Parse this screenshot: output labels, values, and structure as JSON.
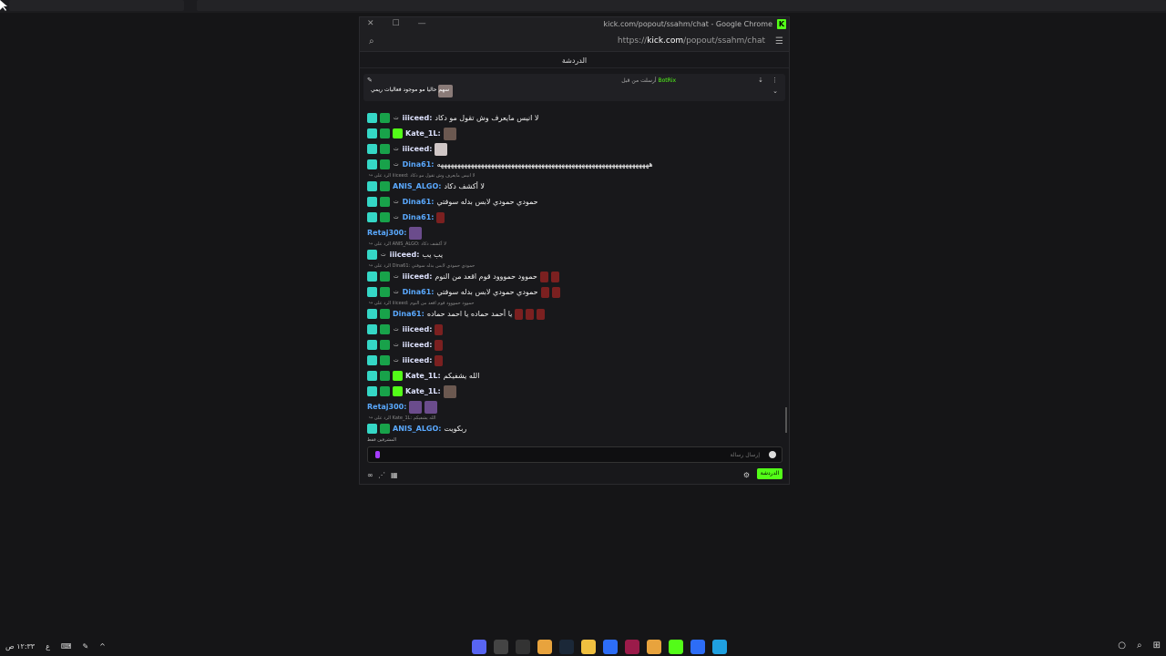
{
  "window": {
    "title": "kick.com/popout/ssahm/chat - Google Chrome",
    "url_prefix": "https://",
    "url_domain": "kick.com",
    "url_path": "/popout/ssahm/chat",
    "logo_letter": "K",
    "controls": [
      "✕",
      "☐",
      "—"
    ]
  },
  "chat": {
    "header": "الدردشة",
    "pinned": {
      "sender": "BotRix",
      "meta": "أرسلت من قبل",
      "message": "سهم حاليا مو موجود فعاليات ريمي"
    },
    "messages": [
      {
        "reply": null,
        "badges": [
          "vip",
          "sub"
        ],
        "tag": "ت",
        "user": "iiiceed",
        "user_color": "white",
        "text": "لا انيس مايعرف وش تقول مو دكاد",
        "emotes": []
      },
      {
        "reply": null,
        "badges": [
          "vip",
          "sub",
          "green"
        ],
        "tag": "",
        "user": "Kate_1L",
        "user_color": "white",
        "text": "",
        "emotes": [
          "face"
        ]
      },
      {
        "reply": null,
        "badges": [
          "vip",
          "sub"
        ],
        "tag": "ت",
        "user": "iiiceed",
        "user_color": "white",
        "text": "",
        "emotes": [
          "girl"
        ]
      },
      {
        "reply": null,
        "badges": [
          "vip",
          "sub"
        ],
        "tag": "ت",
        "user": "Dina61",
        "user_color": "blue",
        "text": "هههههههههههههههههههههههههههههههههههههههههههههههههههههههههههههههه",
        "emotes": []
      },
      {
        "reply": "الرد على iiiceed: لا انيس مايعرف وش تقول مو دكاد",
        "badges": [
          "vip",
          "sub"
        ],
        "tag": "",
        "user": "ANIS_ALGO",
        "user_color": "blue",
        "text": "لا أكشف دكاد",
        "emotes": []
      },
      {
        "reply": null,
        "badges": [
          "vip",
          "sub"
        ],
        "tag": "ت",
        "user": "Dina61",
        "user_color": "blue",
        "text": "حمودي حمودي لابس بدله سوفتي",
        "emotes": []
      },
      {
        "reply": null,
        "badges": [
          "vip",
          "sub"
        ],
        "tag": "ت",
        "user": "Dina61",
        "user_color": "blue",
        "text": "",
        "emotes": [
          "rose"
        ]
      },
      {
        "reply": null,
        "badges": [],
        "tag": "",
        "user": "Retaj300",
        "user_color": "blue",
        "text": "",
        "emotes": [
          "purple"
        ]
      },
      {
        "reply": "الرد على ANIS_ALGO: لا أكشف دكاد",
        "badges": [
          "vip"
        ],
        "tag": "ت",
        "user": "iiiceed",
        "user_color": "white",
        "text": "يب يب",
        "emotes": []
      },
      {
        "reply": "الرد على Dina61: حمودي حمودي لابس بدله سوفتي",
        "badges": [
          "vip",
          "sub"
        ],
        "tag": "ت",
        "user": "iiiceed",
        "user_color": "white",
        "text": "حموود حمووود قوم اقعد من النوم",
        "emotes": [
          "rose",
          "rose"
        ]
      },
      {
        "reply": null,
        "badges": [
          "vip",
          "sub"
        ],
        "tag": "ت",
        "user": "Dina61",
        "user_color": "blue",
        "text": "حمودي حمودي لابس بدله سوفتي",
        "emotes": [
          "rose",
          "rose"
        ]
      },
      {
        "reply": "الرد على iiiceed: حموود حمووود قوم اقعد من النوم",
        "badges": [
          "vip",
          "sub"
        ],
        "tag": "",
        "user": "Dina61",
        "user_color": "blue",
        "text": "يا أحمد حماده يا احمد حماده",
        "emotes": [
          "rose",
          "rose",
          "rose"
        ]
      },
      {
        "reply": null,
        "badges": [
          "vip",
          "sub"
        ],
        "tag": "ت",
        "user": "iiiceed",
        "user_color": "white",
        "text": "",
        "emotes": [
          "rose"
        ]
      },
      {
        "reply": null,
        "badges": [
          "vip",
          "sub"
        ],
        "tag": "ت",
        "user": "iiiceed",
        "user_color": "white",
        "text": "",
        "emotes": [
          "rose"
        ]
      },
      {
        "reply": null,
        "badges": [
          "vip",
          "sub"
        ],
        "tag": "ت",
        "user": "iiiceed",
        "user_color": "white",
        "text": "",
        "emotes": [
          "rose"
        ]
      },
      {
        "reply": null,
        "badges": [
          "vip",
          "sub",
          "green"
        ],
        "tag": "",
        "user": "Kate_1L",
        "user_color": "white",
        "text": "الله يشفيكم",
        "emotes": []
      },
      {
        "reply": null,
        "badges": [
          "vip",
          "sub",
          "green"
        ],
        "tag": "",
        "user": "Kate_1L",
        "user_color": "white",
        "text": "",
        "emotes": [
          "face"
        ]
      },
      {
        "reply": null,
        "badges": [],
        "tag": "",
        "user": "Retaj300",
        "user_color": "blue",
        "text": "",
        "emotes": [
          "purple",
          "purple"
        ]
      },
      {
        "reply": "الرد على Kate_1L: الله يشفيكم",
        "badges": [
          "vip",
          "sub"
        ],
        "tag": "",
        "user": "ANIS_ALGO",
        "user_color": "blue",
        "text": "ربكويت",
        "emotes": []
      }
    ],
    "moderators_label": "المشرفين فقط",
    "input_placeholder": "إرسال رسالة",
    "send_label": "الدردشة"
  },
  "taskbar": {
    "time": "١٢:٣٣ ص",
    "lang": "ع",
    "apps": [
      "discord",
      "settings",
      "steam-alt",
      "chrome",
      "steam",
      "folder",
      "app",
      "app-red",
      "chrome",
      "kick",
      "app",
      "edge"
    ]
  }
}
